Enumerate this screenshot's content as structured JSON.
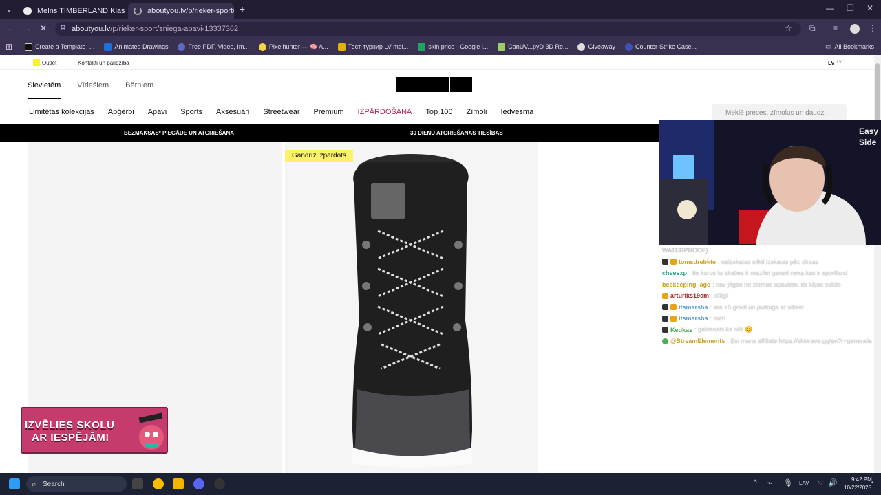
{
  "browser": {
    "tabs": [
      {
        "label": "Melns TIMBERLAND Klasiskie Z",
        "active": false
      },
      {
        "label": "aboutyou.lv/p/rieker-sport/snieg",
        "active": true
      }
    ],
    "url_domain": "aboutyou.lv",
    "url_path": "/p/rieker-sport/sniega-apavi-13337362",
    "bookmarks": [
      "Create a Template -...",
      "Animated Drawings",
      "Free PDF, Video, Im...",
      "Pixelhunter — 🧠 A...",
      "Тест-турнир LV mei...",
      "skin price - Google i...",
      "CanUV...pyD 3D Re...",
      "Giveaway",
      "Counter-Strike Case..."
    ],
    "all_bookmarks": "All Bookmarks"
  },
  "site": {
    "top": {
      "outlet": "Outlet",
      "contact": "Kontakti un palīdzība",
      "lang": "LV",
      "lang_small": "LV"
    },
    "gender_nav": [
      "Sievietēm",
      "Vīriešiem",
      "Bērniem"
    ],
    "categories": [
      "Limitētas kolekcijas",
      "Apģērbi",
      "Apavi",
      "Sports",
      "Aksesuāri",
      "Streetwear",
      "Premium",
      "IZPĀRDOŠANA",
      "Top 100",
      "Zīmoli",
      "Iedvesma"
    ],
    "search_placeholder": "Meklē preces, zīmolus un daudz...",
    "promo_left": "BEZMAKSAS* PIEGĀDE UN ATGRIEŠANA",
    "promo_center": "30 DIENU ATGRIEŠANAS TIESĪBAS",
    "badge": "Gandrīz izpārdots"
  },
  "chat": {
    "first_line": "WATERPROOF)",
    "messages": [
      {
        "user": "tomsdrebkte",
        "text": ": neizskatas slikti izskatas pēc dirsas",
        "color": "#c9a227"
      },
      {
        "user": "cheesxp",
        "text": ": tie kurus tu skaties ir mazliet garaki neka kas ir sportland",
        "color": "#2aa58b"
      },
      {
        "user": "beekeeping_age",
        "text": ": nav jēgas no ziemas apaviem, tik kājas svīdis",
        "color": "#c9a227"
      },
      {
        "user": "arturiks19cm",
        "text": ": dīlīgi",
        "color": "#b22222"
      },
      {
        "user": "itsmarsha",
        "text": ": ara +5 gradi un jaatoiga ar sitiem",
        "color": "#5b9bd5"
      },
      {
        "user": "itsmarsha",
        "text": ": meh",
        "color": "#5b9bd5"
      },
      {
        "user": "Kedkas",
        "text": ": galvenais ka silti 😊",
        "color": "#4caf50"
      },
      {
        "user": "@StreamElements",
        "text": ": Esi mans affiliate https://skinrave.gg/en?r=generalis",
        "color": "#c9a227"
      }
    ]
  },
  "ad": {
    "line1": "IZVĒLIES SKOLU",
    "line2": "AR IESPĒJĀM!"
  },
  "taskbar": {
    "search": "Search",
    "lang": "LAV",
    "time": "9:42 PM",
    "date": "10/22/2025"
  }
}
